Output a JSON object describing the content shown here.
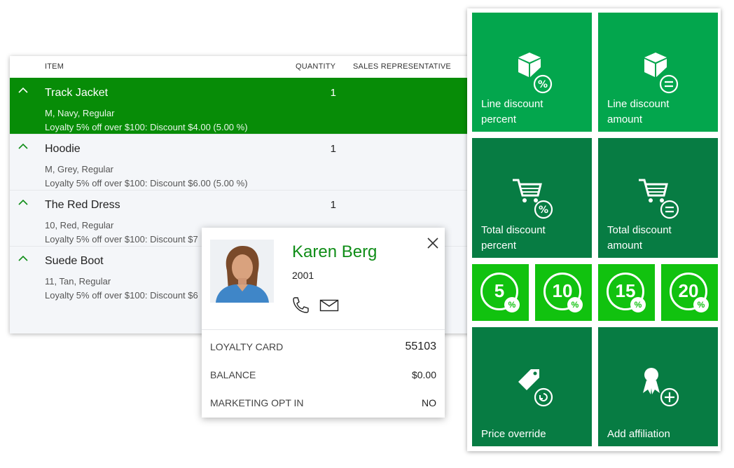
{
  "grid": {
    "headers": {
      "item": "ITEM",
      "quantity": "QUANTITY",
      "sales_rep": "SALES REPRESENTATIVE"
    },
    "rows": [
      {
        "name": "Track Jacket",
        "qty": "1",
        "attrs": "M, Navy, Regular",
        "discount": "Loyalty 5% off over $100: Discount $4.00 (5.00 %)",
        "selected": true
      },
      {
        "name": "Hoodie",
        "qty": "1",
        "attrs": "M, Grey, Regular",
        "discount": "Loyalty 5% off over $100: Discount $6.00 (5.00 %)"
      },
      {
        "name": "The Red Dress",
        "qty": "1",
        "attrs": "10, Red, Regular",
        "discount": "Loyalty 5% off over $100: Discount $7"
      },
      {
        "name": "Suede Boot",
        "qty": "",
        "attrs": "11, Tan, Regular",
        "discount": "Loyalty 5% off over $100: Discount $6"
      }
    ],
    "colors": {
      "selected": "#078c07",
      "accent": "#0f8d17"
    }
  },
  "customer": {
    "name": "Karen Berg",
    "id": "2001",
    "icons": {
      "phone": "phone-icon",
      "email": "mail-icon",
      "close": "close-icon"
    },
    "fields": [
      {
        "label": "LOYALTY CARD",
        "value": "55103"
      },
      {
        "label": "BALANCE",
        "value": "$0.00"
      },
      {
        "label": "MARKETING OPT IN",
        "value": "NO"
      }
    ]
  },
  "panel": {
    "line_discount_percent": "Line discount percent",
    "line_discount_amount": "Line discount amount",
    "total_discount_percent": "Total discount percent",
    "total_discount_amount": "Total discount amount",
    "quick": [
      {
        "value": "5",
        "badge": "%"
      },
      {
        "value": "10",
        "badge": "%"
      },
      {
        "value": "15",
        "badge": "%"
      },
      {
        "value": "20",
        "badge": "%"
      }
    ],
    "price_override": "Price override",
    "add_affiliation": "Add affiliation",
    "colors": {
      "light": "#03a64d",
      "dark": "#077c43",
      "bright": "#11c20f"
    }
  }
}
